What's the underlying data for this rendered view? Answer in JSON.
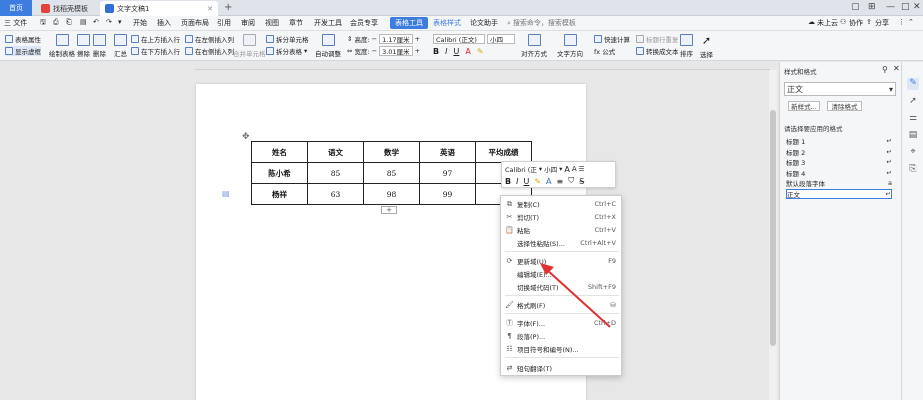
{
  "titlebar": {
    "tabs": [
      {
        "label": "首页",
        "icon": "home-icon"
      },
      {
        "label": "找稻壳模板",
        "icon": "docer-icon"
      },
      {
        "label": "文字文稿1",
        "icon": "wps-writer-icon"
      }
    ],
    "new_tab": "+",
    "cloud_label": "未上云",
    "collab_label": "协作",
    "share_label": "分享"
  },
  "menubar": {
    "file_label": "三 文件",
    "items": [
      "开始",
      "插入",
      "页面布局",
      "引用",
      "审阅",
      "视图",
      "章节",
      "开发工具",
      "会员专享",
      "表格工具",
      "表格样式",
      "论文助手"
    ],
    "active_item": "表格工具",
    "search_placeholder": "搜索命令，搜索模板"
  },
  "ribbon": {
    "table_props": "表格属性",
    "show_grid": "显示虚框",
    "draw_table": "绘制表格",
    "erase": "擦除",
    "delete": "删除",
    "summary": "汇总",
    "insert_above": "在上方插入行",
    "insert_below": "在下方插入行",
    "insert_left": "在左侧插入列",
    "insert_right": "在右侧插入列",
    "merge_cells": "合并单元格",
    "split_cells": "拆分单元格",
    "split_table": "拆分表格",
    "auto_fit": "自动调整",
    "height_label": "高度:",
    "height_value": "1.17厘米",
    "width_label": "宽度:",
    "width_value": "3.01厘米",
    "font_name": "Calibri (正文)",
    "font_size": "小四",
    "align": "对齐方式",
    "text_direction": "文字方向",
    "quick_calc": "快速计算",
    "formula": "fx 公式",
    "title_repeat": "标题行重复",
    "to_text": "转换成文本",
    "sort": "排序",
    "select": "选择"
  },
  "table": {
    "rows": [
      [
        "姓名",
        "语文",
        "数学",
        "英语",
        "平均成绩"
      ],
      [
        "陈小希",
        "85",
        "85",
        "97",
        "8"
      ],
      [
        "杨祥",
        "63",
        "98",
        "99",
        ""
      ]
    ]
  },
  "mini_toolbar": {
    "font": "Calibri (正",
    "size": "小四"
  },
  "context_menu": {
    "items": [
      {
        "label": "复制(C)",
        "shortcut": "Ctrl+C",
        "icon": "copy-icon"
      },
      {
        "label": "剪切(T)",
        "shortcut": "Ctrl+X",
        "icon": "cut-icon"
      },
      {
        "label": "粘贴",
        "shortcut": "Ctrl+V",
        "icon": "paste-icon"
      },
      {
        "label": "选择性粘贴(S)...",
        "shortcut": "Ctrl+Alt+V",
        "icon": "paste-special-icon"
      },
      {
        "label": "更新域(U)",
        "shortcut": "F9",
        "icon": "update-field-icon"
      },
      {
        "label": "编辑域(E)...",
        "shortcut": "",
        "icon": ""
      },
      {
        "label": "切换域代码(T)",
        "shortcut": "Shift+F9",
        "icon": ""
      },
      {
        "label": "格式刷(F)",
        "shortcut": "",
        "icon": "format-painter-icon"
      },
      {
        "label": "字体(F)...",
        "shortcut": "Ctrl+D",
        "icon": "font-icon"
      },
      {
        "label": "段落(P)...",
        "shortcut": "",
        "icon": "paragraph-icon"
      },
      {
        "label": "项目符号和编号(N)...",
        "shortcut": "",
        "icon": "bullets-icon"
      },
      {
        "label": "短句翻译(T)",
        "shortcut": "",
        "icon": "translate-icon"
      }
    ]
  },
  "side_panel": {
    "title": "样式和格式",
    "current_style": "正文",
    "new_style_btn": "新样式...",
    "clear_format_btn": "清除格式",
    "apply_label": "请选择要应用的格式",
    "styles": [
      "标题 1",
      "标题 2",
      "标题 3",
      "标题 4",
      "默认段落字体",
      "正文"
    ]
  },
  "colors": {
    "accent": "#3d7de0",
    "arrow": "#e03030"
  }
}
